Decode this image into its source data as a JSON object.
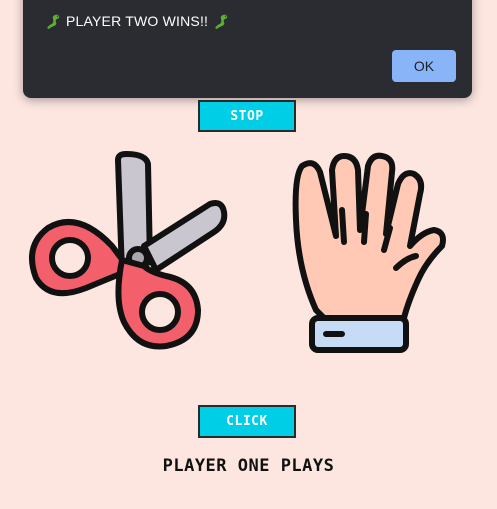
{
  "dialog": {
    "message": "PLAYER TWO WINS!!",
    "leading_icon": "lizard-icon",
    "trailing_icon": "lizard-icon",
    "ok_label": "OK"
  },
  "game": {
    "stop_label": "STOP",
    "click_label": "CLICK",
    "status": "PLAYER ONE PLAYS",
    "player_one_hand": "scissors-icon",
    "player_two_hand": "paper-hand-icon"
  },
  "colors": {
    "background": "#fde6e0",
    "button": "#00cde6",
    "dialog": "#2b2c31",
    "dialog_ok": "#8ab4f8"
  }
}
